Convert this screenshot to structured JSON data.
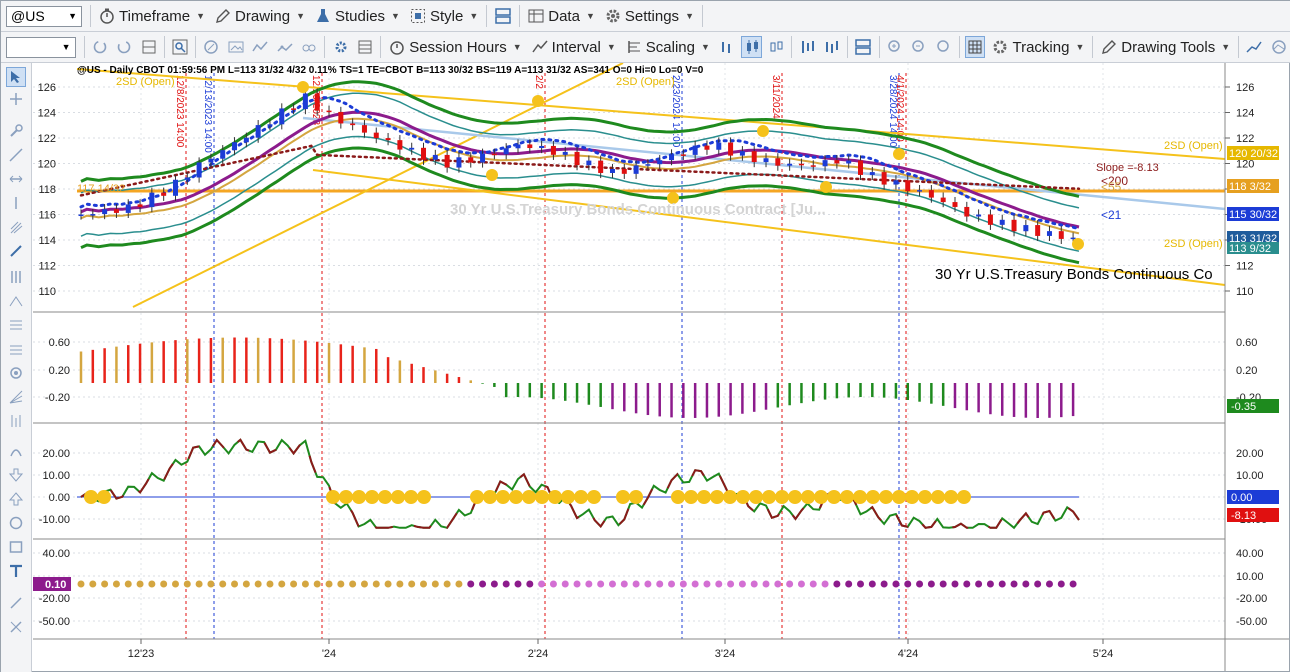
{
  "toolbar1": {
    "symbol": "@US",
    "timeframe": "Timeframe",
    "drawing": "Drawing",
    "studies": "Studies",
    "style": "Style",
    "data": "Data",
    "settings": "Settings"
  },
  "toolbar2": {
    "session_hours": "Session Hours",
    "interval": "Interval",
    "scaling": "Scaling",
    "tracking": "Tracking",
    "drawing_tools": "Drawing Tools"
  },
  "chart": {
    "header": "@US - Daily  CBOT  01:59:56 PM  L=113 31/32  4/32  0.11%  TS=1  TE=CBOT  B=113 30/32  BS=119  A=113 31/32  AS=341  O=0  Hi=0  Lo=0  V=0",
    "watermark": "30 Yr U.S.Treasury Bonds Continuous Contract [Ju...",
    "bottom_title": "30 Yr U.S.Treasury Bonds Continuous Co",
    "price_axis": [
      "126",
      "124",
      "122",
      "120",
      "118",
      "116",
      "114",
      "112",
      "110"
    ],
    "price_tags": {
      "upper": "120 20/32",
      "mid": "118 3/32",
      "blue": "115 30/32",
      "last": "113 31/32",
      "lower": "113 9/32"
    },
    "labels": {
      "sd_open": "2SD (Open)",
      "level_left": "117 14/32",
      "slope": "Slope =-8.13",
      "ma200": "<200",
      "ma55": "<55",
      "ma21": "<21"
    },
    "event_lines": [
      "12/8/2023 14:00",
      "12/13/2023 14:00",
      "12/29/2023",
      "2/2",
      "2/23/2024 14:00",
      "3/11/2024",
      "3/28/2024 14:00",
      "4/1/2024 14:00"
    ],
    "osc1_axis": [
      "0.60",
      "0.20",
      "-0.20"
    ],
    "osc1_tag": "-0.35",
    "osc2_axis": [
      "20.00",
      "10.00",
      "0.00",
      "-10.00"
    ],
    "osc2_tags": {
      "zero": "0.00",
      "value": "-8.13"
    },
    "osc3_axis": [
      "40.00",
      "10.00",
      "-20.00",
      "-50.00"
    ],
    "osc3_tag": "0.10",
    "x_axis": [
      "12'23",
      "'24",
      "2'24",
      "3'24",
      "4'24",
      "5'24"
    ]
  },
  "colors": {
    "up": "#1c3cd6",
    "down": "#e01010",
    "hist_red": "#e8231a",
    "hist_gold": "#d4a640",
    "hist_purple": "#8c1b8c",
    "hist_green": "#1e8a1e",
    "band_green": "#1e8a1e",
    "band_teal": "#2a8e8e",
    "channel": "#f5c21b",
    "hline": "#f5a623"
  },
  "icons": {
    "timeframe": "stopwatch-icon",
    "drawing": "pencil-icon",
    "studies": "flask-icon",
    "style": "style-icon",
    "data": "data-icon",
    "settings": "gear-icon"
  }
}
